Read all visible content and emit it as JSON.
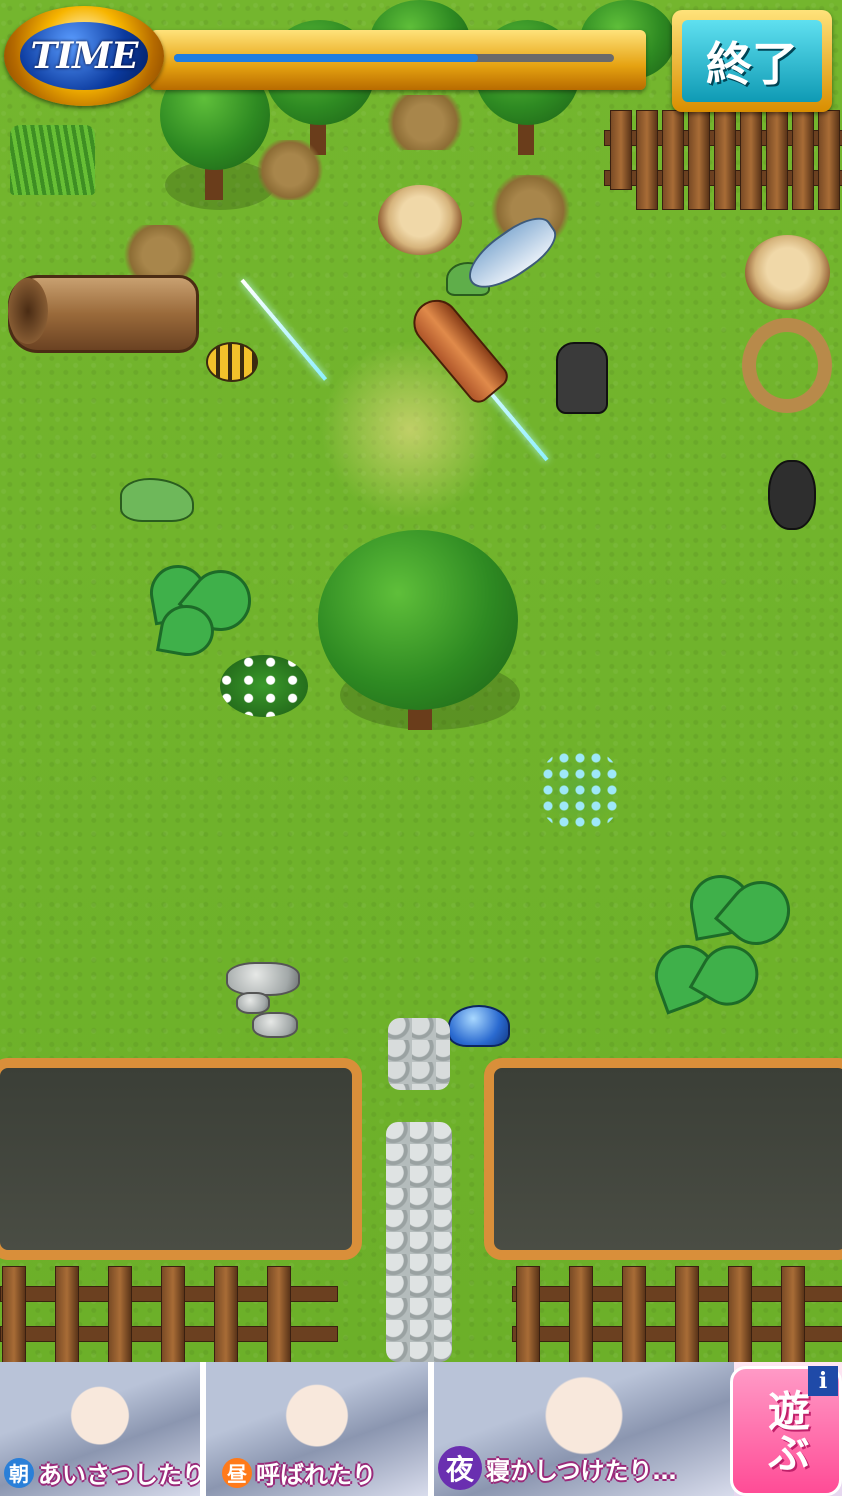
{
  "hud": {
    "time_label": "TIME",
    "time_remaining_fraction": 0.69,
    "end_button_label": "終了"
  },
  "ad": {
    "panels": [
      {
        "badge": "朝",
        "badge_color": "#2a7fd8",
        "text": "あいさつしたり"
      },
      {
        "badge": "昼",
        "badge_color": "#ff7a1a",
        "text": "呼ばれたり"
      },
      {
        "badge": "夜",
        "badge_color": "#6a2fb0",
        "text": "寝かしつけたり…"
      }
    ],
    "play_label": "遊ぶ",
    "info_label": "i"
  },
  "colors": {
    "grass": "#72b42d",
    "accent_gold": "#f2b01e",
    "end_button_teal": "#2ec3d6",
    "pond_border": "#d98f3a",
    "ad_pink": "#ff5fa2"
  }
}
